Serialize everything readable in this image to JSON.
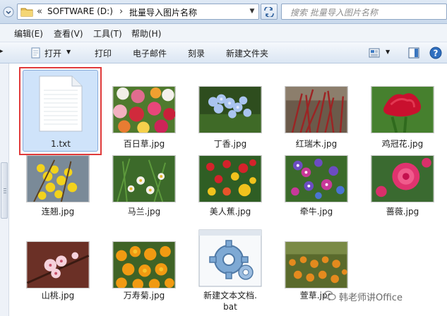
{
  "address_bar": {
    "breadcrumb_prefix": "«",
    "drive": "SOFTWARE (D:)",
    "separator": "›",
    "folder": "批量导入图片名称",
    "dropdown": "▼",
    "search_placeholder": "搜索 批量导入图片名称"
  },
  "menu": {
    "items": [
      "编辑(E)",
      "查看(V)",
      "工具(T)",
      "帮助(H)"
    ]
  },
  "toolbar": {
    "open_label": "打开",
    "open_caret": "▼",
    "print_label": "打印",
    "email_label": "电子邮件",
    "burn_label": "刻录",
    "new_folder_label": "新建文件夹",
    "view_caret": "▼"
  },
  "files": [
    {
      "name": "1.txt",
      "type": "text",
      "selected": true
    },
    {
      "name": "百日草.jpg",
      "type": "image"
    },
    {
      "name": "丁香.jpg",
      "type": "image"
    },
    {
      "name": "红瑞木.jpg",
      "type": "image"
    },
    {
      "name": "鸡冠花.jpg",
      "type": "image"
    },
    {
      "name": "连翘.jpg",
      "type": "image"
    },
    {
      "name": "马兰.jpg",
      "type": "image"
    },
    {
      "name": "美人蕉.jpg",
      "type": "image"
    },
    {
      "name": "牵牛.jpg",
      "type": "image"
    },
    {
      "name": "蔷薇.jpg",
      "type": "image"
    },
    {
      "name": "山桃.jpg",
      "type": "image"
    },
    {
      "name": "万寿菊.jpg",
      "type": "image"
    },
    {
      "name_line1": "新建文本文档.",
      "name_line2": "bat",
      "type": "batch"
    },
    {
      "name": "萱草.jpg",
      "type": "image"
    }
  ],
  "watermark": "韩老师讲Office",
  "colors": {
    "selection_border": "#e03a3a",
    "selection_fill": "#cfe3fa",
    "chrome_blue": "#c9d9ec"
  }
}
